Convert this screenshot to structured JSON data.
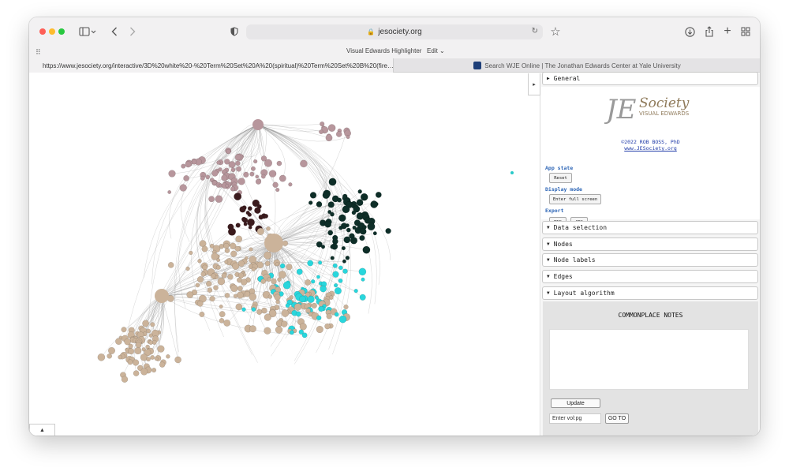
{
  "browser": {
    "address": "jesociety.org",
    "extension_title": "Visual Edwards Highlighter",
    "extension_edit": "Edit ⌄",
    "tabs": [
      {
        "label": "https://www.jesociety.org/interactive/3D%20white%20-%20Term%20Set%20A%20(spiritual)%20Term%20Set%20B%20(fire…",
        "active": true
      },
      {
        "label": "Search WJE Online | The Jonathan Edwards Center at Yale University",
        "active": false
      }
    ],
    "icons": [
      "sidebar-icon",
      "back-icon",
      "forward-icon",
      "shield-icon",
      "lock-icon",
      "reload-icon",
      "star-icon",
      "download-icon",
      "share-icon",
      "new-tab-icon",
      "tab-overview-icon",
      "grid-icon"
    ]
  },
  "graph": {
    "toggle_label": "▸",
    "bottom_label": "▲",
    "colors": {
      "pink": "#b7969c",
      "tan": "#cbb39a",
      "dark_teal": "#0e2e28",
      "cyan": "#29d6dc",
      "maroon": "#3b1b1d",
      "edge": "#8a8a8a"
    }
  },
  "panel": {
    "general_label": "General",
    "logo_text": "Society",
    "logo_sub": "VISUAL EDWARDS",
    "copyright": "©2022 ROB BOSS, PhD",
    "site_link": "www.JESociety.org",
    "app_state_label": "App state",
    "reset_label": "Reset",
    "display_mode_label": "Display mode",
    "fullscreen_label": "Enter full screen",
    "export_label": "Export",
    "png_label": "PNG",
    "jpg_label": "JPG",
    "sections": [
      "Data selection",
      "Nodes",
      "Node labels",
      "Edges",
      "Layout algorithm"
    ],
    "notes_title": "COMMONPLACE NOTES",
    "update_label": "Update",
    "vol_placeholder": "Enter vol:pg",
    "goto_label": "GO TO"
  }
}
